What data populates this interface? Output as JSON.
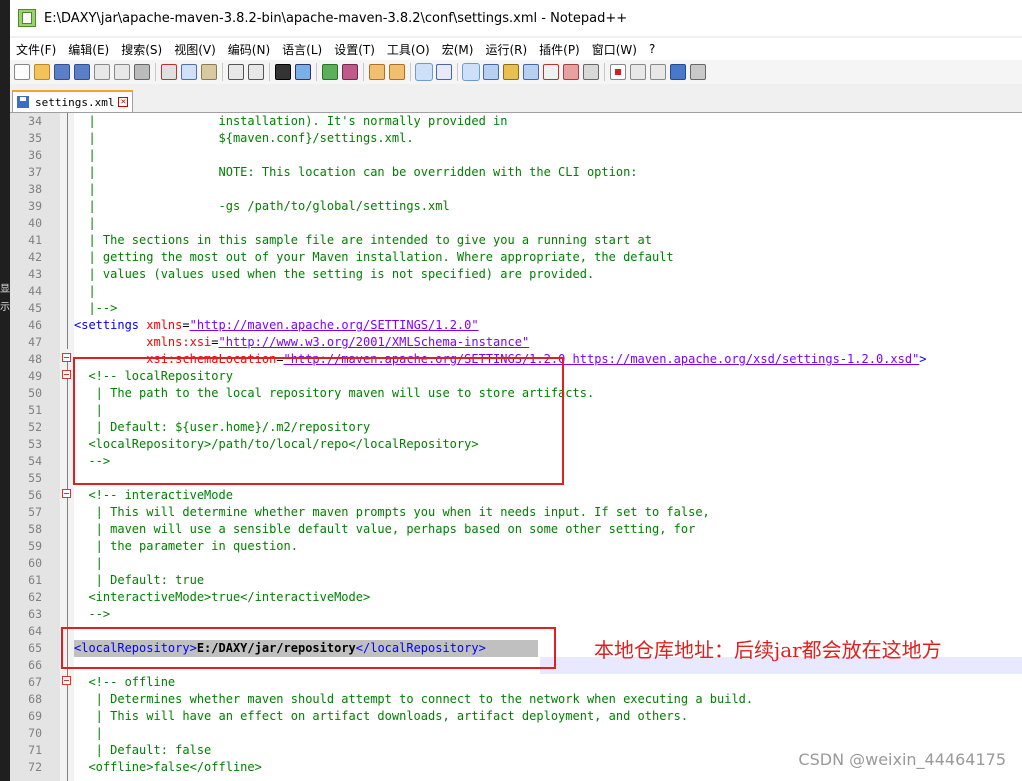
{
  "window": {
    "title": "E:\\DAXY\\jar\\apache-maven-3.8.2-bin\\apache-maven-3.8.2\\conf\\settings.xml - Notepad++"
  },
  "menu": [
    "文件(F)",
    "编辑(E)",
    "搜索(S)",
    "视图(V)",
    "编码(N)",
    "语言(L)",
    "设置(T)",
    "工具(O)",
    "宏(M)",
    "运行(R)",
    "插件(P)",
    "窗口(W)",
    "?"
  ],
  "left_strip": [
    "显",
    "示"
  ],
  "tab": {
    "label": "settings.xml"
  },
  "annotation": "本地仓库地址：后续jar都会放在这地方",
  "watermark": "CSDN @weixin_44464175",
  "colors": {
    "comment": "#008000",
    "tag": "#0000ff",
    "attribute": "#ff0000",
    "value": "#8000ff",
    "highlight": "#e02020",
    "tab_accent": "#f7a32a"
  },
  "lines": [
    {
      "num": "34",
      "parts": [
        {
          "t": "  |                 installation). It's normally provided in",
          "c": "comment"
        }
      ]
    },
    {
      "num": "35",
      "parts": [
        {
          "t": "  |                 ${maven.conf}/settings.xml.",
          "c": "comment"
        }
      ]
    },
    {
      "num": "36",
      "parts": [
        {
          "t": "  |",
          "c": "comment"
        }
      ]
    },
    {
      "num": "37",
      "parts": [
        {
          "t": "  |                 NOTE: This location can be overridden with the CLI option:",
          "c": "comment"
        }
      ]
    },
    {
      "num": "38",
      "parts": [
        {
          "t": "  |",
          "c": "comment"
        }
      ]
    },
    {
      "num": "39",
      "parts": [
        {
          "t": "  |                 -gs /path/to/global/settings.xml",
          "c": "comment"
        }
      ]
    },
    {
      "num": "40",
      "parts": [
        {
          "t": "  |",
          "c": "comment"
        }
      ]
    },
    {
      "num": "41",
      "parts": [
        {
          "t": "  | The sections in this sample file are intended to give you a running start at",
          "c": "comment"
        }
      ]
    },
    {
      "num": "42",
      "parts": [
        {
          "t": "  | getting the most out of your Maven installation. Where appropriate, the default",
          "c": "comment"
        }
      ]
    },
    {
      "num": "43",
      "parts": [
        {
          "t": "  | values (values used when the setting is not specified) are provided.",
          "c": "comment"
        }
      ]
    },
    {
      "num": "44",
      "parts": [
        {
          "t": "  |",
          "c": "comment"
        }
      ]
    },
    {
      "num": "45",
      "parts": [
        {
          "t": "  |-->",
          "c": "comment"
        }
      ]
    },
    {
      "num": "46",
      "parts": [
        {
          "t": "<settings ",
          "c": "tag"
        },
        {
          "t": "xmlns",
          "c": "attr"
        },
        {
          "t": "=",
          "c": "pl"
        },
        {
          "t": "\"http://maven.apache.org/SETTINGS/1.2.0\"",
          "c": "val"
        }
      ]
    },
    {
      "num": "47",
      "parts": [
        {
          "t": "          ",
          "c": "pl"
        },
        {
          "t": "xmlns:xsi",
          "c": "attr"
        },
        {
          "t": "=",
          "c": "pl"
        },
        {
          "t": "\"http://www.w3.org/2001/XMLSchema-instance\"",
          "c": "val"
        }
      ]
    },
    {
      "num": "48",
      "parts": [
        {
          "t": "          ",
          "c": "pl"
        },
        {
          "t": "xsi:schemaLocation",
          "c": "attr"
        },
        {
          "t": "=",
          "c": "pl"
        },
        {
          "t": "\"http://maven.apache.org/SETTINGS/1.2.0 https://maven.apache.org/xsd/settings-1.2.0.xsd\"",
          "c": "val"
        },
        {
          "t": ">",
          "c": "tag"
        }
      ]
    },
    {
      "num": "49",
      "parts": [
        {
          "t": "  <!-- localRepository",
          "c": "comment"
        }
      ]
    },
    {
      "num": "50",
      "parts": [
        {
          "t": "   | The path to the local repository maven will use to store artifacts.",
          "c": "comment"
        }
      ]
    },
    {
      "num": "51",
      "parts": [
        {
          "t": "   |",
          "c": "comment"
        }
      ]
    },
    {
      "num": "52",
      "parts": [
        {
          "t": "   | Default: ${user.home}/.m2/repository",
          "c": "comment"
        }
      ]
    },
    {
      "num": "53",
      "parts": [
        {
          "t": "  <localRepository>/path/to/local/repo</localRepository>",
          "c": "comment"
        }
      ]
    },
    {
      "num": "54",
      "parts": [
        {
          "t": "  -->",
          "c": "comment"
        }
      ]
    },
    {
      "num": "55",
      "parts": []
    },
    {
      "num": "56",
      "parts": [
        {
          "t": "  <!-- interactiveMode",
          "c": "comment"
        }
      ]
    },
    {
      "num": "57",
      "parts": [
        {
          "t": "   | This will determine whether maven prompts you when it needs input. If set to false,",
          "c": "comment"
        }
      ]
    },
    {
      "num": "58",
      "parts": [
        {
          "t": "   | maven will use a sensible default value, perhaps based on some other setting, for",
          "c": "comment"
        }
      ]
    },
    {
      "num": "59",
      "parts": [
        {
          "t": "   | the parameter in question.",
          "c": "comment"
        }
      ]
    },
    {
      "num": "60",
      "parts": [
        {
          "t": "   |",
          "c": "comment"
        }
      ]
    },
    {
      "num": "61",
      "parts": [
        {
          "t": "   | Default: true",
          "c": "comment"
        }
      ]
    },
    {
      "num": "62",
      "parts": [
        {
          "t": "  <interactiveMode>true</interactiveMode>",
          "c": "comment"
        }
      ]
    },
    {
      "num": "63",
      "parts": [
        {
          "t": "  -->",
          "c": "comment"
        }
      ]
    },
    {
      "num": "64",
      "parts": []
    },
    {
      "num": "65",
      "parts": [
        {
          "t": "<localRepository>",
          "c": "tag"
        },
        {
          "t": "E:/DAXY/jar/repository",
          "c": "plb"
        },
        {
          "t": "</localRepository>",
          "c": "tag"
        }
      ]
    },
    {
      "num": "66",
      "parts": []
    },
    {
      "num": "67",
      "parts": [
        {
          "t": "  <!-- offline",
          "c": "comment"
        }
      ]
    },
    {
      "num": "68",
      "parts": [
        {
          "t": "   | Determines whether maven should attempt to connect to the network when executing a build.",
          "c": "comment"
        }
      ]
    },
    {
      "num": "69",
      "parts": [
        {
          "t": "   | This will have an effect on artifact downloads, artifact deployment, and others.",
          "c": "comment"
        }
      ]
    },
    {
      "num": "70",
      "parts": [
        {
          "t": "   |",
          "c": "comment"
        }
      ]
    },
    {
      "num": "71",
      "parts": [
        {
          "t": "   | Default: false",
          "c": "comment"
        }
      ]
    },
    {
      "num": "72",
      "parts": [
        {
          "t": "  <offline>false</offline>",
          "c": "comment"
        }
      ]
    }
  ]
}
